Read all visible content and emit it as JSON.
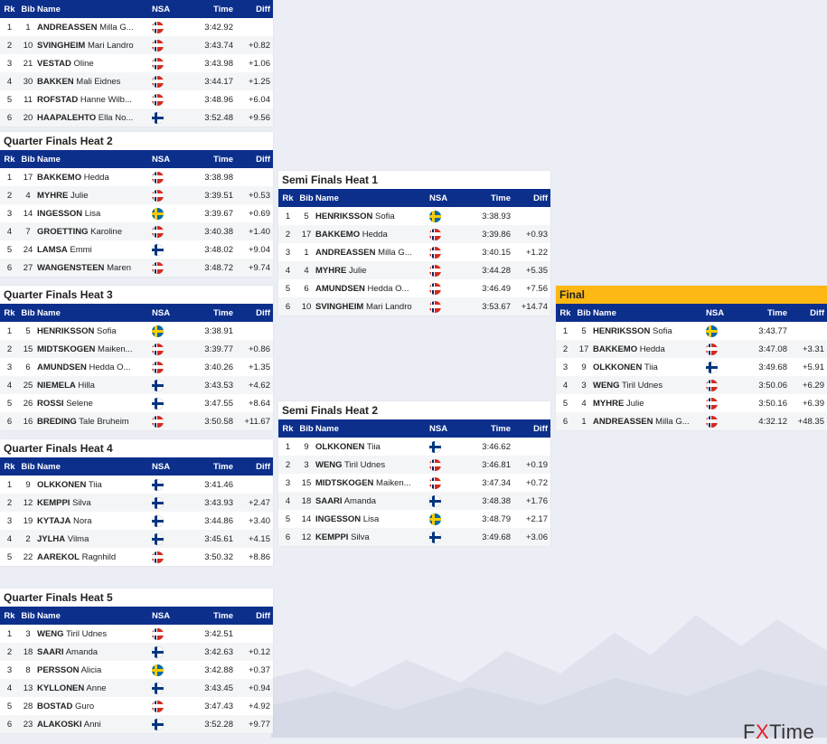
{
  "headers": {
    "rk": "Rk",
    "bib": "Bib",
    "name": "Name",
    "nsa": "NSA",
    "time": "Time",
    "diff": "Diff"
  },
  "heats": [
    {
      "id": "qf1",
      "title": "",
      "rows": [
        {
          "rk": "1",
          "bib": "1",
          "last": "ANDREASSEN",
          "first": "Milla G...",
          "nsa": "NOR",
          "time": "3:42.92",
          "diff": ""
        },
        {
          "rk": "2",
          "bib": "10",
          "last": "SVINGHEIM",
          "first": "Mari Landro",
          "nsa": "NOR",
          "time": "3:43.74",
          "diff": "+0.82"
        },
        {
          "rk": "3",
          "bib": "21",
          "last": "VESTAD",
          "first": "Oline",
          "nsa": "NOR",
          "time": "3:43.98",
          "diff": "+1.06"
        },
        {
          "rk": "4",
          "bib": "30",
          "last": "BAKKEN",
          "first": "Mali Eidnes",
          "nsa": "NOR",
          "time": "3:44.17",
          "diff": "+1.25"
        },
        {
          "rk": "5",
          "bib": "11",
          "last": "ROFSTAD",
          "first": "Hanne Wilb...",
          "nsa": "NOR",
          "time": "3:48.96",
          "diff": "+6.04"
        },
        {
          "rk": "6",
          "bib": "20",
          "last": "HAAPALEHTO",
          "first": "Ella No...",
          "nsa": "FIN",
          "time": "3:52.48",
          "diff": "+9.56"
        }
      ]
    },
    {
      "id": "qf2",
      "title": "Quarter Finals Heat 2",
      "rows": [
        {
          "rk": "1",
          "bib": "17",
          "last": "BAKKEMO",
          "first": "Hedda",
          "nsa": "NOR",
          "time": "3:38.98",
          "diff": ""
        },
        {
          "rk": "2",
          "bib": "4",
          "last": "MYHRE",
          "first": "Julie",
          "nsa": "NOR",
          "time": "3:39.51",
          "diff": "+0.53"
        },
        {
          "rk": "3",
          "bib": "14",
          "last": "INGESSON",
          "first": "Lisa",
          "nsa": "SWE",
          "time": "3:39.67",
          "diff": "+0.69"
        },
        {
          "rk": "4",
          "bib": "7",
          "last": "GROETTING",
          "first": "Karoline",
          "nsa": "NOR",
          "time": "3:40.38",
          "diff": "+1.40"
        },
        {
          "rk": "5",
          "bib": "24",
          "last": "LAMSA",
          "first": "Emmi",
          "nsa": "FIN",
          "time": "3:48.02",
          "diff": "+9.04"
        },
        {
          "rk": "6",
          "bib": "27",
          "last": "WANGENSTEEN",
          "first": "Maren",
          "nsa": "NOR",
          "time": "3:48.72",
          "diff": "+9.74"
        }
      ]
    },
    {
      "id": "qf3",
      "title": "Quarter Finals Heat 3",
      "rows": [
        {
          "rk": "1",
          "bib": "5",
          "last": "HENRIKSSON",
          "first": "Sofia",
          "nsa": "SWE",
          "time": "3:38.91",
          "diff": ""
        },
        {
          "rk": "2",
          "bib": "15",
          "last": "MIDTSKOGEN",
          "first": "Maiken...",
          "nsa": "NOR",
          "time": "3:39.77",
          "diff": "+0.86"
        },
        {
          "rk": "3",
          "bib": "6",
          "last": "AMUNDSEN",
          "first": "Hedda O...",
          "nsa": "NOR",
          "time": "3:40.26",
          "diff": "+1.35"
        },
        {
          "rk": "4",
          "bib": "25",
          "last": "NIEMELA",
          "first": "Hilla",
          "nsa": "FIN",
          "time": "3:43.53",
          "diff": "+4.62"
        },
        {
          "rk": "5",
          "bib": "26",
          "last": "ROSSI",
          "first": "Selene",
          "nsa": "FIN",
          "time": "3:47.55",
          "diff": "+8.64"
        },
        {
          "rk": "6",
          "bib": "16",
          "last": "BREDING",
          "first": "Tale Bruheim",
          "nsa": "NOR",
          "time": "3:50.58",
          "diff": "+11.67"
        }
      ]
    },
    {
      "id": "qf4",
      "title": "Quarter Finals Heat 4",
      "rows": [
        {
          "rk": "1",
          "bib": "9",
          "last": "OLKKONEN",
          "first": "Tiia",
          "nsa": "FIN",
          "time": "3:41.46",
          "diff": ""
        },
        {
          "rk": "2",
          "bib": "12",
          "last": "KEMPPI",
          "first": "Silva",
          "nsa": "FIN",
          "time": "3:43.93",
          "diff": "+2.47"
        },
        {
          "rk": "3",
          "bib": "19",
          "last": "KYTAJA",
          "first": "Nora",
          "nsa": "FIN",
          "time": "3:44.86",
          "diff": "+3.40"
        },
        {
          "rk": "4",
          "bib": "2",
          "last": "JYLHA",
          "first": "Vilma",
          "nsa": "FIN",
          "time": "3:45.61",
          "diff": "+4.15"
        },
        {
          "rk": "5",
          "bib": "22",
          "last": "AAREKOL",
          "first": "Ragnhild",
          "nsa": "NOR",
          "time": "3:50.32",
          "diff": "+8.86"
        }
      ]
    },
    {
      "id": "qf5",
      "title": "Quarter Finals Heat 5",
      "rows": [
        {
          "rk": "1",
          "bib": "3",
          "last": "WENG",
          "first": "Tiril Udnes",
          "nsa": "NOR",
          "time": "3:42.51",
          "diff": ""
        },
        {
          "rk": "2",
          "bib": "18",
          "last": "SAARI",
          "first": "Amanda",
          "nsa": "FIN",
          "time": "3:42.63",
          "diff": "+0.12"
        },
        {
          "rk": "3",
          "bib": "8",
          "last": "PERSSON",
          "first": "Alicia",
          "nsa": "SWE",
          "time": "3:42.88",
          "diff": "+0.37"
        },
        {
          "rk": "4",
          "bib": "13",
          "last": "KYLLONEN",
          "first": "Anne",
          "nsa": "FIN",
          "time": "3:43.45",
          "diff": "+0.94"
        },
        {
          "rk": "5",
          "bib": "28",
          "last": "BOSTAD",
          "first": "Guro",
          "nsa": "NOR",
          "time": "3:47.43",
          "diff": "+4.92"
        },
        {
          "rk": "6",
          "bib": "23",
          "last": "ALAKOSKI",
          "first": "Anni",
          "nsa": "FIN",
          "time": "3:52.28",
          "diff": "+9.77"
        }
      ]
    },
    {
      "id": "sf1",
      "title": "Semi Finals Heat 1",
      "rows": [
        {
          "rk": "1",
          "bib": "5",
          "last": "HENRIKSSON",
          "first": "Sofia",
          "nsa": "SWE",
          "time": "3:38.93",
          "diff": ""
        },
        {
          "rk": "2",
          "bib": "17",
          "last": "BAKKEMO",
          "first": "Hedda",
          "nsa": "NOR",
          "time": "3:39.86",
          "diff": "+0.93"
        },
        {
          "rk": "3",
          "bib": "1",
          "last": "ANDREASSEN",
          "first": "Milla G...",
          "nsa": "NOR",
          "time": "3:40.15",
          "diff": "+1.22"
        },
        {
          "rk": "4",
          "bib": "4",
          "last": "MYHRE",
          "first": "Julie",
          "nsa": "NOR",
          "time": "3:44.28",
          "diff": "+5.35"
        },
        {
          "rk": "5",
          "bib": "6",
          "last": "AMUNDSEN",
          "first": "Hedda O...",
          "nsa": "NOR",
          "time": "3:46.49",
          "diff": "+7.56"
        },
        {
          "rk": "6",
          "bib": "10",
          "last": "SVINGHEIM",
          "first": "Mari Landro",
          "nsa": "NOR",
          "time": "3:53.67",
          "diff": "+14.74"
        }
      ]
    },
    {
      "id": "sf2",
      "title": "Semi Finals Heat 2",
      "rows": [
        {
          "rk": "1",
          "bib": "9",
          "last": "OLKKONEN",
          "first": "Tiia",
          "nsa": "FIN",
          "time": "3:46.62",
          "diff": ""
        },
        {
          "rk": "2",
          "bib": "3",
          "last": "WENG",
          "first": "Tiril Udnes",
          "nsa": "NOR",
          "time": "3:46.81",
          "diff": "+0.19"
        },
        {
          "rk": "3",
          "bib": "15",
          "last": "MIDTSKOGEN",
          "first": "Maiken...",
          "nsa": "NOR",
          "time": "3:47.34",
          "diff": "+0.72"
        },
        {
          "rk": "4",
          "bib": "18",
          "last": "SAARI",
          "first": "Amanda",
          "nsa": "FIN",
          "time": "3:48.38",
          "diff": "+1.76"
        },
        {
          "rk": "5",
          "bib": "14",
          "last": "INGESSON",
          "first": "Lisa",
          "nsa": "SWE",
          "time": "3:48.79",
          "diff": "+2.17"
        },
        {
          "rk": "6",
          "bib": "12",
          "last": "KEMPPI",
          "first": "Silva",
          "nsa": "FIN",
          "time": "3:49.68",
          "diff": "+3.06"
        }
      ]
    },
    {
      "id": "final",
      "title": "Final",
      "rows": [
        {
          "rk": "1",
          "bib": "5",
          "last": "HENRIKSSON",
          "first": "Sofia",
          "nsa": "SWE",
          "time": "3:43.77",
          "diff": ""
        },
        {
          "rk": "2",
          "bib": "17",
          "last": "BAKKEMO",
          "first": "Hedda",
          "nsa": "NOR",
          "time": "3:47.08",
          "diff": "+3.31"
        },
        {
          "rk": "3",
          "bib": "9",
          "last": "OLKKONEN",
          "first": "Tiia",
          "nsa": "FIN",
          "time": "3:49.68",
          "diff": "+5.91"
        },
        {
          "rk": "4",
          "bib": "3",
          "last": "WENG",
          "first": "Tiril Udnes",
          "nsa": "NOR",
          "time": "3:50.06",
          "diff": "+6.29"
        },
        {
          "rk": "5",
          "bib": "4",
          "last": "MYHRE",
          "first": "Julie",
          "nsa": "NOR",
          "time": "3:50.16",
          "diff": "+6.39"
        },
        {
          "rk": "6",
          "bib": "1",
          "last": "ANDREASSEN",
          "first": "Milla G...",
          "nsa": "NOR",
          "time": "4:32.12",
          "diff": "+48.35"
        }
      ]
    }
  ],
  "logo": {
    "part1": "F",
    "part2": "X",
    "part3": "Time"
  },
  "colors": {
    "header_bg": "#0c2f8c",
    "final_title_bg": "#fdb813",
    "page_bg": "#eceef5"
  }
}
